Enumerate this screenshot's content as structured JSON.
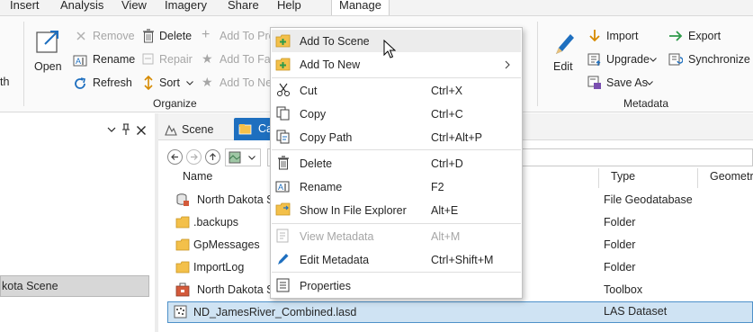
{
  "menubar": {
    "items": [
      "Insert",
      "Analysis",
      "View",
      "Imagery",
      "Share",
      "Help"
    ],
    "active": "Manage"
  },
  "ribbon": {
    "open_partial": "th",
    "open": "Open",
    "remove": "Remove",
    "rename": "Rename",
    "refresh": "Refresh",
    "delete": "Delete",
    "repair": "Repair",
    "sort": "Sort",
    "add_to_project_partial": "Add To Pro",
    "add_to_favorites_partial": "Add To Fav",
    "add_to_new_partial": "Add To Ne",
    "organize_label": "Organize",
    "edit": "Edit",
    "import": "Import",
    "upgrade": "Upgrade",
    "save_as": "Save As",
    "export": "Export",
    "synchronize": "Synchronize",
    "metadata_label": "Metadata"
  },
  "left_pane": {
    "scene_partial": "kota Scene"
  },
  "tabs": {
    "scene": "Scene",
    "catalog_partial": "Ca"
  },
  "catalog": {
    "path_partial": "P",
    "columns": {
      "name": "Name",
      "type": "Type",
      "geometry": "Geometry"
    },
    "rows": [
      {
        "name": "North Dakota S",
        "type": "File Geodatabase"
      },
      {
        "name": ".backups",
        "type": "Folder"
      },
      {
        "name": "GpMessages",
        "type": "Folder"
      },
      {
        "name": "ImportLog",
        "type": "Folder"
      },
      {
        "name": "North Dakota S",
        "type": "Toolbox"
      },
      {
        "name": "ND_JamesRiver_Combined.lasd",
        "type": "LAS Dataset"
      }
    ]
  },
  "context_menu": {
    "items": [
      {
        "label": "Add To Scene",
        "shortcut": ""
      },
      {
        "label": "Add To New",
        "shortcut": ""
      },
      {
        "label": "Cut",
        "shortcut": "Ctrl+X"
      },
      {
        "label": "Copy",
        "shortcut": "Ctrl+C"
      },
      {
        "label": "Copy Path",
        "shortcut": "Ctrl+Alt+P"
      },
      {
        "label": "Delete",
        "shortcut": "Ctrl+D"
      },
      {
        "label": "Rename",
        "shortcut": "F2"
      },
      {
        "label": "Show In File Explorer",
        "shortcut": "Alt+E"
      },
      {
        "label": "View Metadata",
        "shortcut": "Alt+M"
      },
      {
        "label": "Edit Metadata",
        "shortcut": "Ctrl+Shift+M"
      },
      {
        "label": "Properties",
        "shortcut": ""
      }
    ]
  },
  "colors": {
    "accent": "#1e6fbf",
    "selection": "#cfe3f3",
    "selection_border": "#4e91c9",
    "menu_hover": "#ececec",
    "disabled": "#a6a6a6"
  }
}
